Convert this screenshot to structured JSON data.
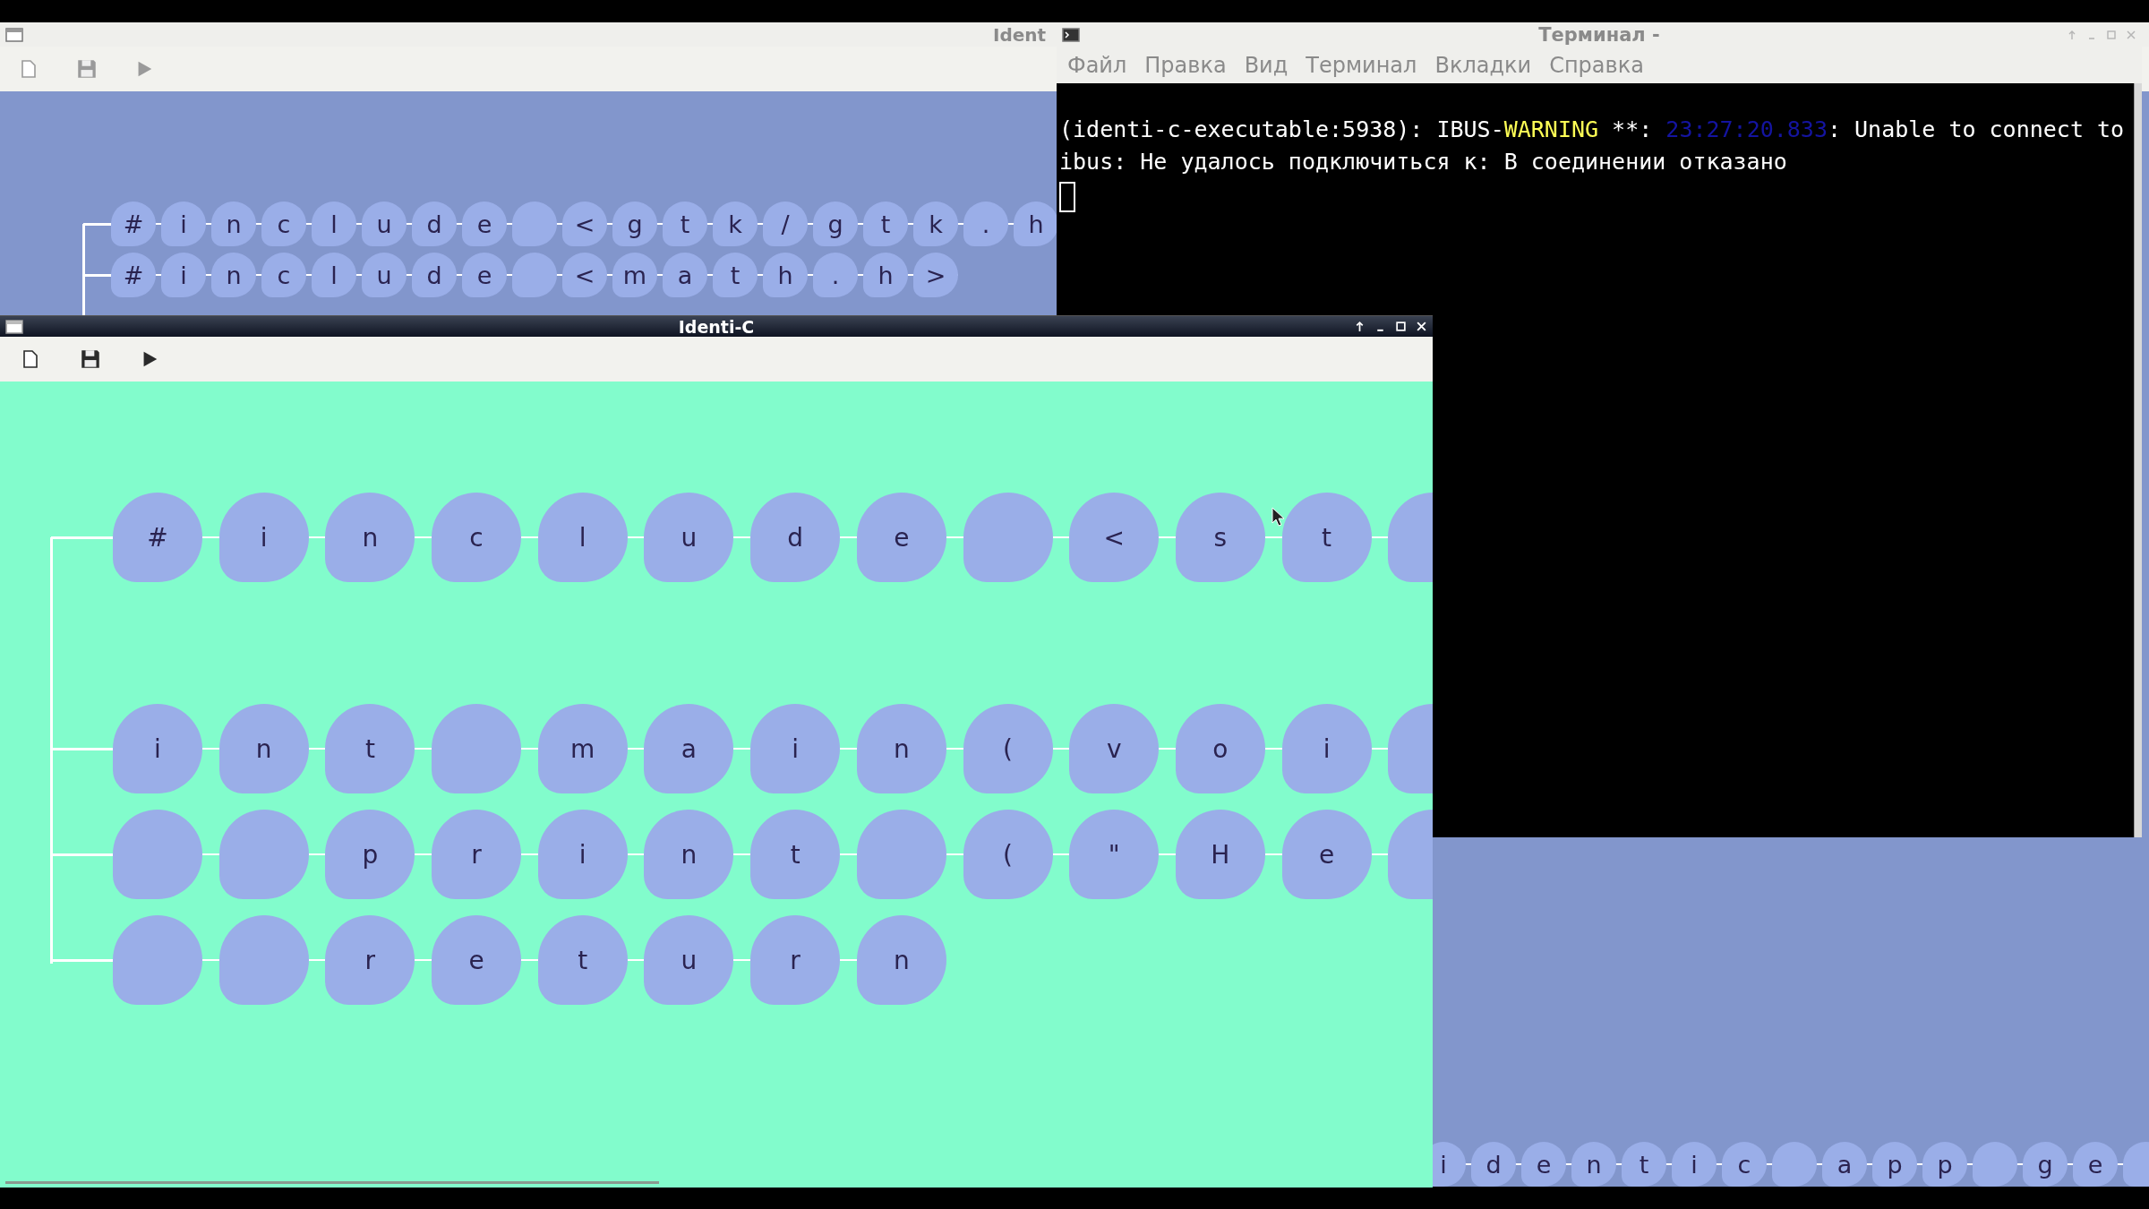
{
  "back_window": {
    "title": "Ident",
    "active": false,
    "rows": [
      {
        "kind": "code",
        "nodes": [
          {
            "kind": "char",
            "text": "#"
          },
          {
            "kind": "char",
            "text": "i"
          },
          {
            "kind": "char",
            "text": "n"
          },
          {
            "kind": "char",
            "text": "c"
          },
          {
            "kind": "char",
            "text": "l"
          },
          {
            "kind": "char",
            "text": "u"
          },
          {
            "kind": "char",
            "text": "d"
          },
          {
            "kind": "char",
            "text": "e"
          },
          {
            "kind": "blank"
          },
          {
            "kind": "char",
            "text": "<"
          },
          {
            "kind": "char",
            "text": "g"
          },
          {
            "kind": "char",
            "text": "t"
          },
          {
            "kind": "char",
            "text": "k"
          },
          {
            "kind": "char",
            "text": "/"
          },
          {
            "kind": "char",
            "text": "g"
          },
          {
            "kind": "char",
            "text": "t"
          },
          {
            "kind": "char",
            "text": "k"
          },
          {
            "kind": "char",
            "text": "."
          },
          {
            "kind": "char",
            "text": "h"
          }
        ]
      },
      {
        "kind": "code",
        "nodes": [
          {
            "kind": "char",
            "text": "#"
          },
          {
            "kind": "char",
            "text": "i"
          },
          {
            "kind": "char",
            "text": "n"
          },
          {
            "kind": "char",
            "text": "c"
          },
          {
            "kind": "char",
            "text": "l"
          },
          {
            "kind": "char",
            "text": "u"
          },
          {
            "kind": "char",
            "text": "d"
          },
          {
            "kind": "char",
            "text": "e"
          },
          {
            "kind": "blank"
          },
          {
            "kind": "char",
            "text": "<"
          },
          {
            "kind": "char",
            "text": "m"
          },
          {
            "kind": "char",
            "text": "a"
          },
          {
            "kind": "char",
            "text": "t"
          },
          {
            "kind": "char",
            "text": "h"
          },
          {
            "kind": "char",
            "text": "."
          },
          {
            "kind": "char",
            "text": "h"
          },
          {
            "kind": "char",
            "text": ">"
          }
        ]
      }
    ],
    "lower_row": [
      {
        "kind": "char",
        "text": "i"
      },
      {
        "kind": "char",
        "text": "d"
      },
      {
        "kind": "char",
        "text": "e"
      },
      {
        "kind": "char",
        "text": "n"
      },
      {
        "kind": "char",
        "text": "t"
      },
      {
        "kind": "char",
        "text": "i"
      },
      {
        "kind": "char",
        "text": "c"
      },
      {
        "kind": "blank"
      },
      {
        "kind": "char",
        "text": "a"
      },
      {
        "kind": "char",
        "text": "p"
      },
      {
        "kind": "char",
        "text": "p"
      },
      {
        "kind": "blank"
      },
      {
        "kind": "char",
        "text": "g"
      },
      {
        "kind": "char",
        "text": "e"
      },
      {
        "kind": "blank"
      }
    ]
  },
  "terminal": {
    "title": "Терминал -",
    "active": false,
    "menu": [
      "Файл",
      "Правка",
      "Вид",
      "Терминал",
      "Вкладки",
      "Справка"
    ],
    "lines": [
      [
        {
          "text": "(identi-c-executable:5938): IBUS-",
          "color": "#ffffff"
        },
        {
          "text": "WARNING",
          "color": "#ffff55"
        },
        {
          "text": " **: ",
          "color": "#ffffff"
        },
        {
          "text": "23:27:20.833",
          "color": "#1414a0"
        },
        {
          "text": ": Unable to connect to",
          "color": "#ffffff"
        }
      ],
      [
        {
          "text": "ibus: Не удалось подключиться к: В соединении отказано",
          "color": "#ffffff"
        }
      ]
    ]
  },
  "front_window": {
    "title": "Identi-C",
    "active": true,
    "rows": [
      {
        "kind": "code",
        "nodes": [
          {
            "kind": "char",
            "text": "#"
          },
          {
            "kind": "char",
            "text": "i"
          },
          {
            "kind": "char",
            "text": "n"
          },
          {
            "kind": "char",
            "text": "c"
          },
          {
            "kind": "char",
            "text": "l"
          },
          {
            "kind": "char",
            "text": "u"
          },
          {
            "kind": "char",
            "text": "d"
          },
          {
            "kind": "char",
            "text": "e"
          },
          {
            "kind": "blank"
          },
          {
            "kind": "char",
            "text": "<"
          },
          {
            "kind": "char",
            "text": "s"
          },
          {
            "kind": "char",
            "text": "t"
          },
          {
            "kind": "blank"
          }
        ]
      },
      {
        "kind": "empty"
      },
      {
        "kind": "code",
        "nodes": [
          {
            "kind": "char",
            "text": "i"
          },
          {
            "kind": "char",
            "text": "n"
          },
          {
            "kind": "char",
            "text": "t"
          },
          {
            "kind": "blank"
          },
          {
            "kind": "char",
            "text": "m"
          },
          {
            "kind": "char",
            "text": "a"
          },
          {
            "kind": "char",
            "text": "i"
          },
          {
            "kind": "char",
            "text": "n"
          },
          {
            "kind": "char",
            "text": "("
          },
          {
            "kind": "char",
            "text": "v"
          },
          {
            "kind": "char",
            "text": "o"
          },
          {
            "kind": "char",
            "text": "i"
          },
          {
            "kind": "blank"
          }
        ]
      },
      {
        "kind": "code",
        "nodes": [
          {
            "kind": "blank"
          },
          {
            "kind": "blank"
          },
          {
            "kind": "char",
            "text": "p"
          },
          {
            "kind": "char",
            "text": "r"
          },
          {
            "kind": "char",
            "text": "i"
          },
          {
            "kind": "char",
            "text": "n"
          },
          {
            "kind": "char",
            "text": "t"
          },
          {
            "kind": "blank"
          },
          {
            "kind": "char",
            "text": "("
          },
          {
            "kind": "char",
            "text": "\""
          },
          {
            "kind": "char",
            "text": "H"
          },
          {
            "kind": "char",
            "text": "e"
          },
          {
            "kind": "blank"
          }
        ]
      },
      {
        "kind": "code",
        "nodes": [
          {
            "kind": "blank"
          },
          {
            "kind": "blank"
          },
          {
            "kind": "char",
            "text": "r"
          },
          {
            "kind": "char",
            "text": "e"
          },
          {
            "kind": "char",
            "text": "t"
          },
          {
            "kind": "char",
            "text": "u"
          },
          {
            "kind": "char",
            "text": "r"
          },
          {
            "kind": "char",
            "text": "n"
          }
        ]
      }
    ]
  }
}
